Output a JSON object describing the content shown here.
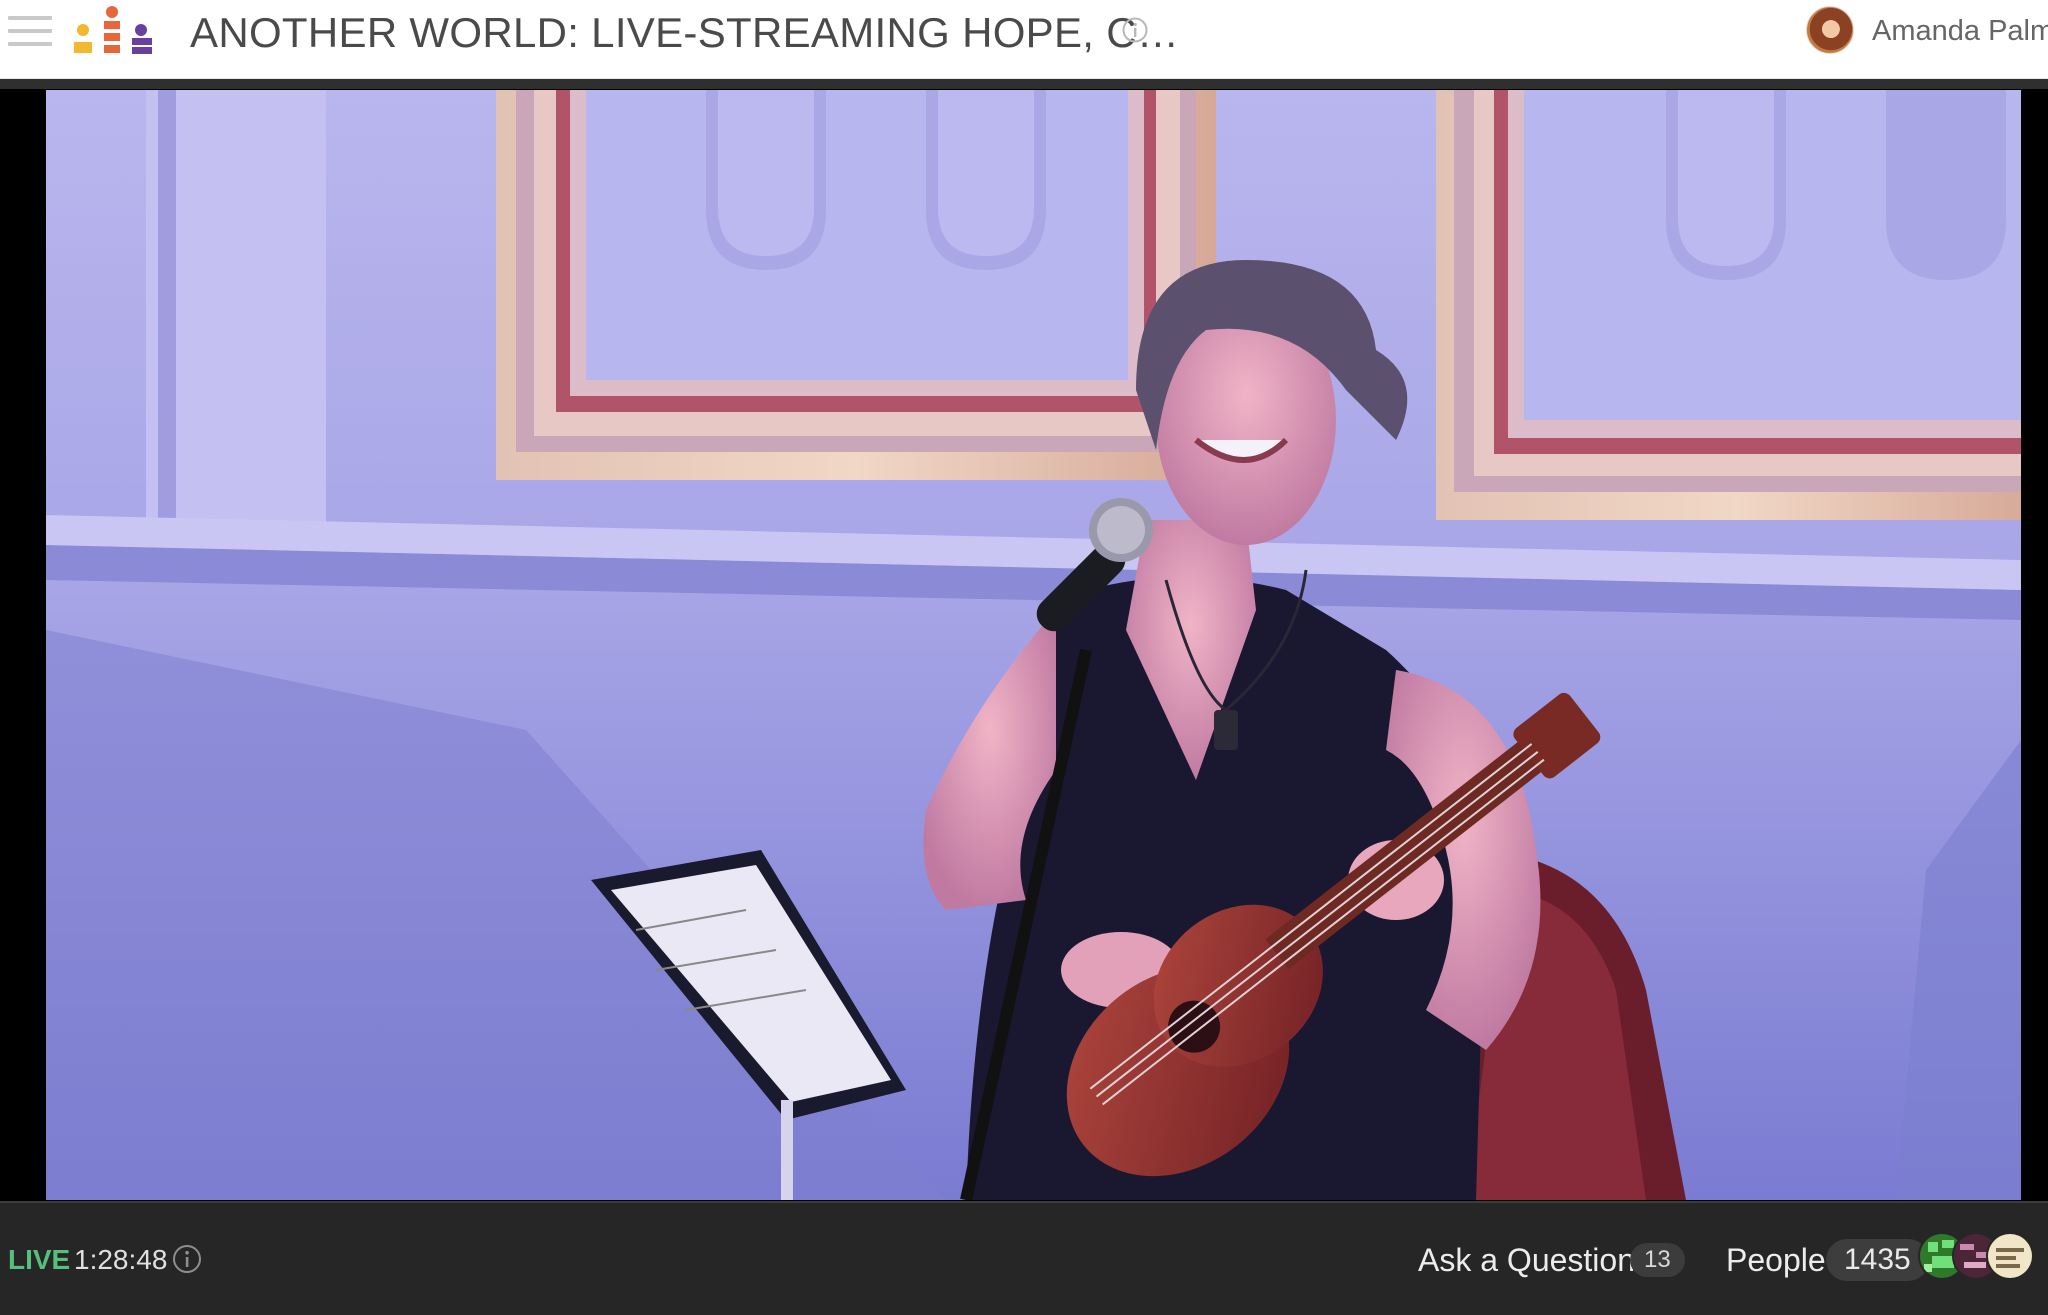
{
  "header": {
    "title": "ANOTHER WORLD: LIVE-STREAMING HOPE, C…",
    "user_name": "Amanda Palme",
    "menu_icon": "hamburger-menu-icon",
    "info_icon": "info-circle-icon",
    "logo_colors": [
      "#f2b830",
      "#e9663a",
      "#6b3fa0"
    ]
  },
  "footer": {
    "live_label": "LIVE",
    "elapsed_time": "1:28:48",
    "ask_question_label": "Ask a Question",
    "question_count": "13",
    "people_label": "People",
    "people_count": "1435",
    "accent_color": "#54c07c"
  }
}
